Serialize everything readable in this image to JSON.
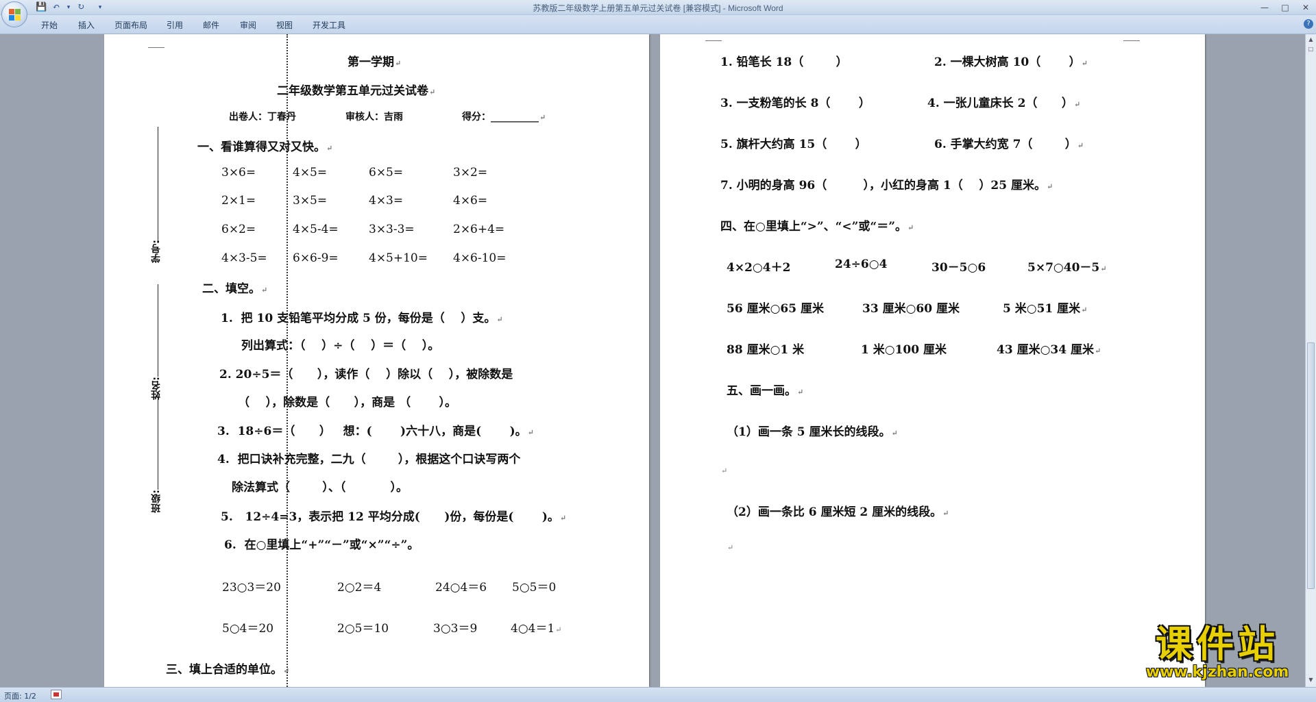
{
  "window": {
    "title": "苏教版二年级数学上册第五单元过关试卷 [兼容模式] - Microsoft Word",
    "min": "—",
    "max": "□",
    "close": "✕"
  },
  "quick_access": {
    "save_icon": "save-icon",
    "undo_icon": "undo-icon",
    "redo_icon": "redo-icon",
    "customize_icon": "dropdown-icon"
  },
  "ribbon": {
    "tabs": [
      "开始",
      "插入",
      "页面布局",
      "引用",
      "邮件",
      "审阅",
      "视图",
      "开发工具"
    ],
    "help": "?"
  },
  "status": {
    "page": "页面: 1/2"
  },
  "margin": {
    "xuehao": "学号:",
    "xingming": "姓名:",
    "banji": "班级:"
  },
  "page1": {
    "heading": "第一学期",
    "subtitle": "二年级数学第五单元过关试卷",
    "author": "出卷人：丁春丹",
    "reviewer": "审核人：吉雨",
    "score": "得分：__________",
    "s1_title": "一、看谁算得又对又快。",
    "calc": [
      [
        "3×6=",
        "4×5=",
        "6×5=",
        "3×2="
      ],
      [
        "2×1=",
        "3×5=",
        "4×3=",
        "4×6="
      ],
      [
        "6×2=",
        "4×5-4=",
        "3×3-3=",
        "2×6+4="
      ],
      [
        "4×3-5=",
        "6×6-9=",
        "4×5+10=",
        "4×6-10="
      ]
    ],
    "s2_title": "二、填空。",
    "q1": "1.  把 10 支铅笔平均分成 5 份，每份是（    ）支。",
    "q1b": "列出算式：（    ）÷（    ）＝（    ）。",
    "q2": "2. 20÷5＝（      ），读作（    ）除以（    ），被除数是",
    "q2b": "（    ），除数是（      ），商是 （       ）。",
    "q3": "3.  18÷6＝（      ）   想：(       )六十八，商是(       )。",
    "q4": "4.  把口诀补充完整，二九（        ），根据这个口诀写两个",
    "q4b": "除法算式（        ）、（           ）。",
    "q5": "5.   12÷4=3，表示把 12 平均分成(      )份，每份是(       )。",
    "q6": "6.  在○里填上“+”“－”或“×”“÷”。",
    "fill_row1": [
      "23○3＝20",
      "2○2＝4",
      "24○4＝6",
      "5○5＝0"
    ],
    "fill_row2": [
      "5○4＝20",
      "2○5＝10",
      "3○3＝9",
      "4○4＝1"
    ],
    "s3_title": "三、填上合适的单位。"
  },
  "page2": {
    "u1": "1. 铅笔长 18（        ）",
    "u2": "2. 一棵大树高 10（       ）",
    "u3": "3. 一支粉笔的长 8（       ）",
    "u4": "4. 一张儿童床长 2（      ）",
    "u5": "5. 旗杆大约高 15（       ）",
    "u6": "6. 手掌大约宽 7（        ）",
    "u7": "7. 小明的身高 96（         ），小红的身高 1（    ）25 厘米。",
    "s4_title": "四、在○里填上“>”、“<”或“＝”。",
    "cmp_row1": [
      "4×2○4＋2",
      "24÷6○4",
      "30－5○6",
      "5×7○40－5"
    ],
    "cmp_row2": [
      "56 厘米○65 厘米",
      "33 厘米○60 厘米",
      "5 米○51 厘米"
    ],
    "cmp_row3": [
      "88 厘米○1 米",
      "1 米○100 厘米",
      "43 厘米○34 厘米"
    ],
    "s5_title": "五、画一画。",
    "d1": "（1）画一条 5 厘米长的线段。",
    "d2": "（2）画一条比 6 厘米短 2 厘米的线段。"
  },
  "watermark": {
    "title": "课件站",
    "url": "www.kjzhan.com"
  }
}
